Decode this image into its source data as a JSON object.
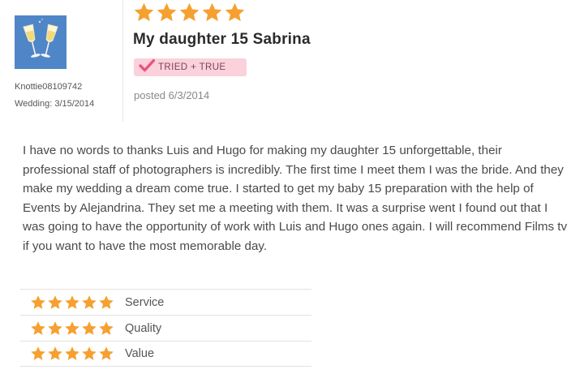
{
  "reviewer": {
    "avatar_icon": "champagne-glasses-icon",
    "username": "Knottie08109742",
    "wedding_date": "Wedding: 3/15/2014"
  },
  "review": {
    "overall_rating": 5,
    "max_rating": 5,
    "title": "My daughter 15 Sabrina",
    "badge": {
      "icon": "checkmark-icon",
      "label": "TRIED + TRUE"
    },
    "posted": "posted 6/3/2014",
    "body": "I have no words to thanks Luis and Hugo for making my daughter 15 unforgettable, their professional staff of photographers is incredibly. The first time I meet them I was the bride. And they make my wedding a dream come true. I started to get my baby 15 preparation with the help of Events by Alejandrina. They set me a meeting with them. It was a surprise went I found out that I was going to have the opportunity of work with Luis and Hugo ones again. I will recommend Films tv if you want to have the most memorable day."
  },
  "ratings": [
    {
      "label": "Service",
      "stars": 5
    },
    {
      "label": "Quality",
      "stars": 5
    },
    {
      "label": "Value",
      "stars": 5
    }
  ],
  "colors": {
    "star": "#f5a030",
    "badge_bg": "#fbd1dc",
    "badge_check": "#e8557f",
    "avatar_bg": "#4f86c7"
  }
}
